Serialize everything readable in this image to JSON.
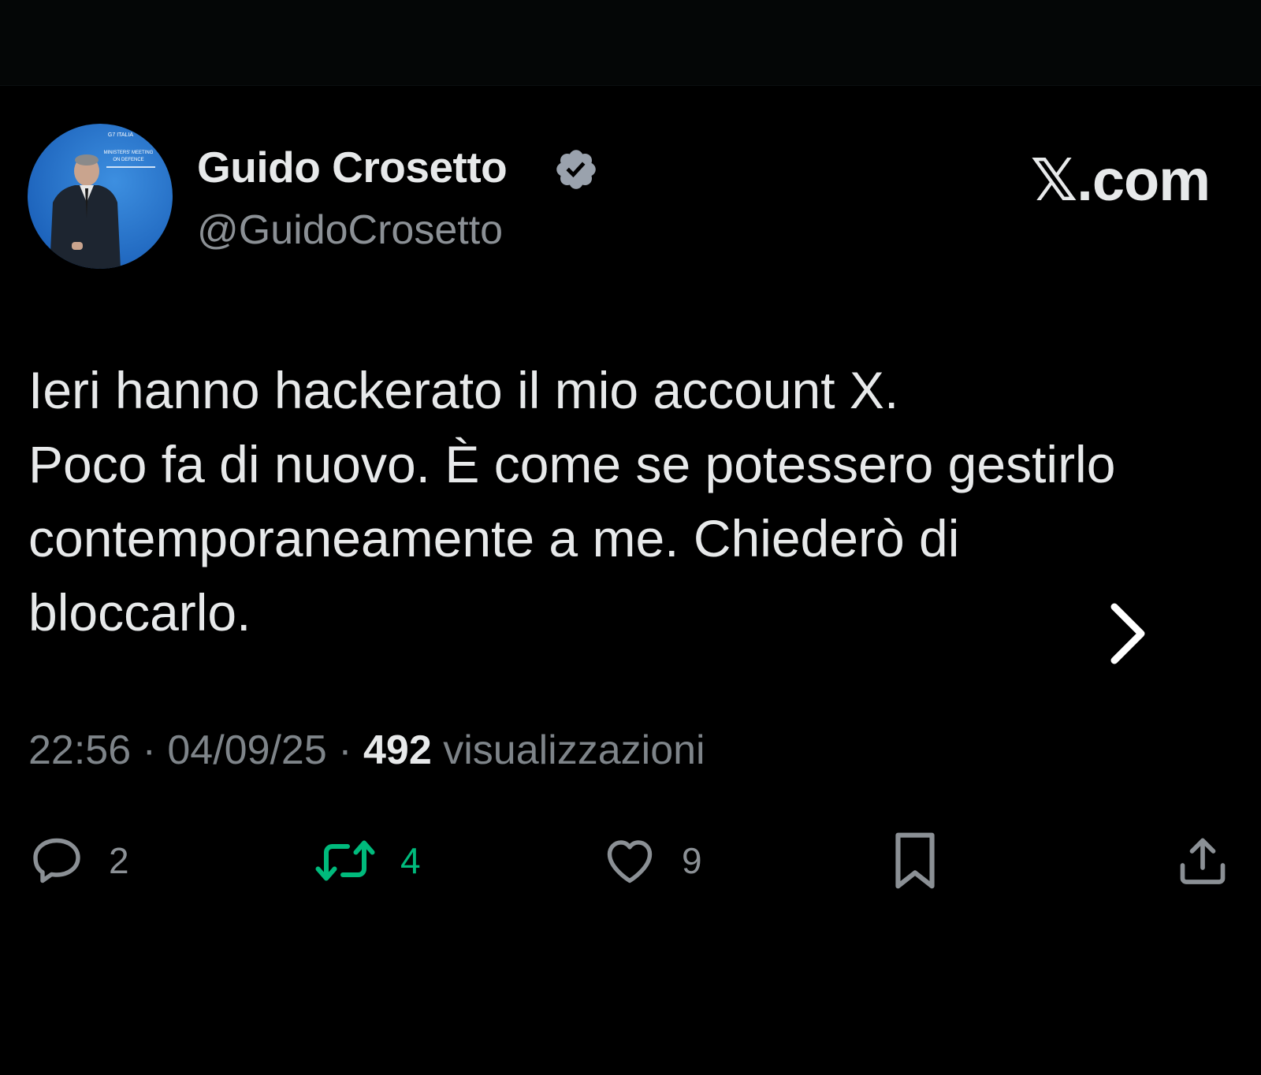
{
  "header": {
    "display_name": "Guido Crosetto",
    "handle": "@GuidoCrosetto",
    "verified": true,
    "site_logo": "𝕏.com"
  },
  "avatar": {
    "banner_lines": [
      "G7 ITALIA",
      "MINISTERS' MEETING",
      "ON DEFENCE"
    ]
  },
  "tweet": {
    "text": "Ieri hanno hackerato il mio account X.\nPoco fa di nuovo. È come se potessero gestirlo contemporaneamente a me. Chiederò di bloccarlo.",
    "time": "22:56",
    "date": "04/09/25",
    "separator": " · ",
    "views_count": "492",
    "views_label": "visualizzazioni"
  },
  "actions": {
    "reply_count": "2",
    "retweet_count": "4",
    "like_count": "9"
  },
  "icons": {
    "verified": "verified-badge-icon",
    "next": "chevron-right-icon",
    "reply": "reply-icon",
    "retweet": "retweet-icon",
    "like": "heart-icon",
    "bookmark": "bookmark-icon",
    "share": "share-icon"
  },
  "colors": {
    "background": "#000000",
    "text_primary": "#e7e9ea",
    "text_secondary": "#8b9095",
    "retweet_green": "#00ba7c",
    "verified_badge": "#9aa2ad"
  }
}
